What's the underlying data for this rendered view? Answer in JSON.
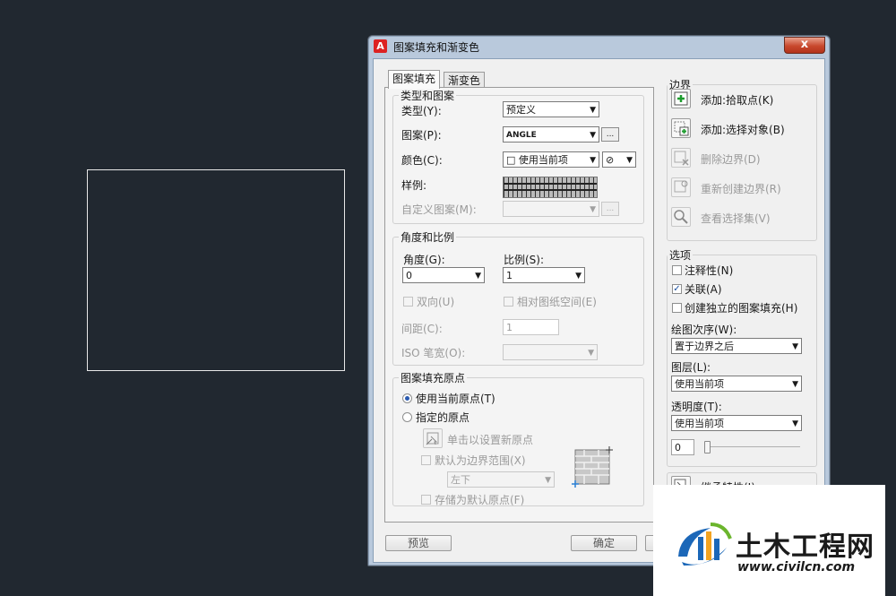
{
  "window": {
    "title": "图案填充和渐变色",
    "close_label": "x"
  },
  "tabs": [
    {
      "label": "图案填充"
    },
    {
      "label": "渐变色"
    }
  ],
  "type_pattern": {
    "legend": "类型和图案",
    "type_label": "类型(Y):",
    "type_value": "预定义",
    "pattern_label": "图案(P):",
    "pattern_value": "ANGLE",
    "color_label": "颜色(C):",
    "color_value": "□ 使用当前项",
    "sample_label": "样例:",
    "custom_label": "自定义图案(M):",
    "browse_label": "..."
  },
  "angle_scale": {
    "legend": "角度和比例",
    "angle_label": "角度(G):",
    "angle_value": "0",
    "scale_label": "比例(S):",
    "scale_value": "1",
    "double_label": "双向(U)",
    "relative_label": "相对图纸空间(E)",
    "spacing_label": "间距(C):",
    "spacing_value": "1",
    "iso_label": "ISO 笔宽(O):"
  },
  "origin": {
    "legend": "图案填充原点",
    "use_current_label": "使用当前原点(T)",
    "specified_label": "指定的原点",
    "click_set_label": "单击以设置新原点",
    "default_extent_label": "默认为边界范围(X)",
    "position_value": "左下",
    "store_default_label": "存储为默认原点(F)"
  },
  "boundaries": {
    "legend": "边界",
    "add_pick_label": "添加:拾取点(K)",
    "add_select_label": "添加:选择对象(B)",
    "remove_label": "删除边界(D)",
    "recreate_label": "重新创建边界(R)",
    "view_label": "查看选择集(V)"
  },
  "options": {
    "legend": "选项",
    "annotative_label": "注释性(N)",
    "associative_label": "关联(A)",
    "separate_label": "创建独立的图案填充(H)",
    "draw_order_label": "绘图次序(W):",
    "draw_order_value": "置于边界之后",
    "layer_label": "图层(L):",
    "layer_value": "使用当前项",
    "transparency_label": "透明度(T):",
    "transparency_value": "使用当前项",
    "transparency_number": "0"
  },
  "inherit_label": "继承特性(I)",
  "footer": {
    "preview_label": "预览",
    "ok_label": "确定"
  },
  "watermark": {
    "brand": "土木工程网",
    "url": "www.civilcn.com"
  }
}
